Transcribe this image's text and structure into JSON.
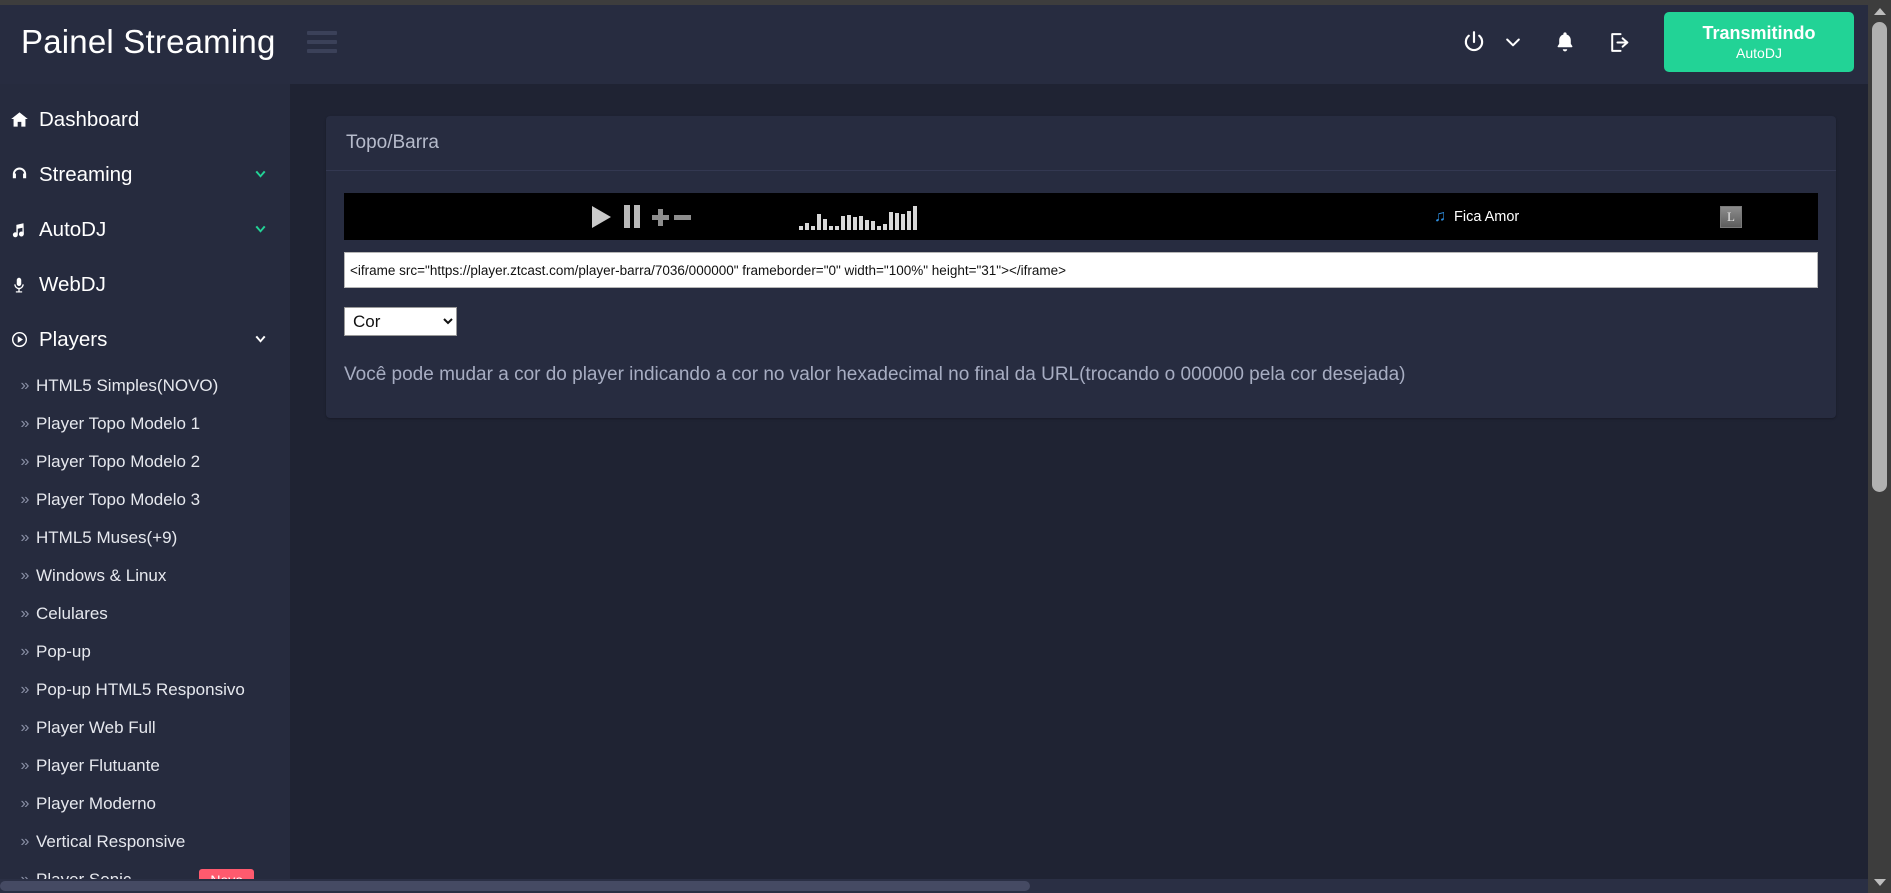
{
  "header": {
    "brand": "Painel Streaming",
    "menu_toggle": "menu",
    "power_icon": "power-icon",
    "caret_icon": "chevron-down-icon",
    "bell_icon": "bell-icon",
    "logout_icon": "logout-icon",
    "live_button": {
      "title": "Transmitindo",
      "subtitle": "AutoDJ",
      "color": "#22d396"
    }
  },
  "sidebar": {
    "items": [
      {
        "label": "Dashboard",
        "icon": "home-icon",
        "chevron": null
      },
      {
        "label": "Streaming",
        "icon": "headphones-icon",
        "chevron": "green"
      },
      {
        "label": "AutoDJ",
        "icon": "music-note-icon",
        "chevron": "green"
      },
      {
        "label": "WebDJ",
        "icon": "microphone-icon",
        "chevron": null
      },
      {
        "label": "Players",
        "icon": "play-circle-icon",
        "chevron": "white"
      }
    ],
    "sub_items": [
      {
        "label": "HTML5 Simples(NOVO)",
        "badge": null
      },
      {
        "label": "Player Topo Modelo 1",
        "badge": null
      },
      {
        "label": "Player Topo Modelo 2",
        "badge": null
      },
      {
        "label": "Player Topo Modelo 3",
        "badge": null
      },
      {
        "label": "HTML5 Muses(+9)",
        "badge": null
      },
      {
        "label": "Windows & Linux",
        "badge": null
      },
      {
        "label": "Celulares",
        "badge": null
      },
      {
        "label": "Pop-up",
        "badge": null
      },
      {
        "label": "Pop-up HTML5 Responsivo",
        "badge": null
      },
      {
        "label": "Player Web Full",
        "badge": null
      },
      {
        "label": "Player Flutuante",
        "badge": null
      },
      {
        "label": "Player Moderno",
        "badge": null
      },
      {
        "label": "Vertical Responsive",
        "badge": null
      },
      {
        "label": "Player Sonic",
        "badge": "Novo"
      }
    ],
    "badge_color": "#ff5a6e"
  },
  "main": {
    "card_title": "Topo/Barra",
    "player_preview": {
      "play_icon": "play-icon",
      "pause_icon": "pause-icon",
      "volume_up_icon": "plus-icon",
      "volume_down_icon": "minus-icon",
      "equalizer_icon": "equalizer-bars-icon",
      "track_note_icon": "music-note-icon",
      "track_title": "Fica Amor",
      "right_icon_label": "L"
    },
    "embed_code": "<iframe src=\"https://player.ztcast.com/player-barra/7036/000000\" frameborder=\"0\" width=\"100%\" height=\"31\"></iframe>",
    "color_select": {
      "selected": "Cor",
      "options": [
        "Cor"
      ]
    },
    "hint": "Você pode mudar a cor do player indicando a cor no valor hexadecimal no final da URL(trocando o 000000 pela cor desejada)"
  }
}
